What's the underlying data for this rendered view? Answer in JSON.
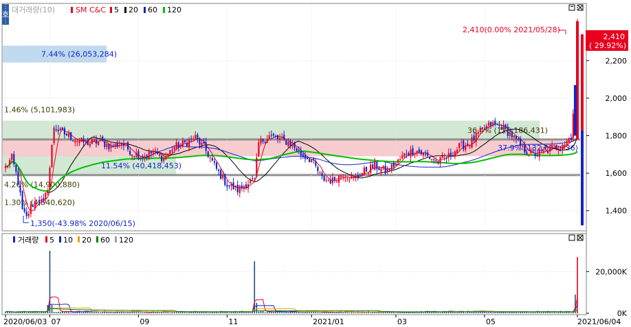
{
  "side_tab": "호",
  "price_pane": {
    "legend": {
      "title": "대거래량(10)",
      "stock": "SM C&C",
      "ma_items": [
        {
          "label": "5",
          "color": "#e8001e"
        },
        {
          "label": "20",
          "color": "#000000"
        },
        {
          "label": "60",
          "color": "#1024c8"
        },
        {
          "label": "120",
          "color": "#00c000"
        }
      ]
    },
    "y_ticks": [
      "2,200",
      "2,000",
      "1,800",
      "1,600",
      "1,400"
    ],
    "high_annotation": "2,410(0.00% 2021/05/28)",
    "low_annotation": "1,350(-43.98% 2020/06/15)",
    "current_price": "2,410",
    "current_change": "( 29.92%)",
    "volume_profile": [
      {
        "label": "7.44% (26,053,284)",
        "low": 2190,
        "high": 2280,
        "color": "#b8d6ec",
        "width": 0.18
      },
      {
        "label": "1.46% (5,101,983)",
        "low": 1880,
        "high": 2000,
        "color": "#ffffff",
        "width": 0.13
      },
      {
        "label": "36.4% (128,186,431)",
        "low": 1780,
        "high": 1880,
        "color": "#cde6cf",
        "width": 0.93
      },
      {
        "label": "37.9% (132,604,736)",
        "low": 1690,
        "high": 1780,
        "color": "#f5c6c9",
        "width": 0.97
      },
      {
        "label": "11.54% (40,418,453)",
        "low": 1590,
        "high": 1690,
        "color": "#cde6cf",
        "width": 0.3
      },
      {
        "label": "4.26% (14,900,880)",
        "low": 1490,
        "high": 1590,
        "color": "#ffffff",
        "width": 0.11
      },
      {
        "label": "1.30% (4,540,620)",
        "low": 1400,
        "high": 1490,
        "color": "#ffffff",
        "width": 0.1
      }
    ],
    "support_lines": [
      1780,
      1590
    ]
  },
  "volume_pane": {
    "legend": {
      "title": "거래량",
      "ma_items": [
        {
          "label": "5",
          "color": "#e8001e"
        },
        {
          "label": "10",
          "color": "#1024c8"
        },
        {
          "label": "20",
          "color": "#e8a000"
        },
        {
          "label": "60",
          "color": "#008000"
        },
        {
          "label": "120",
          "color": "#a0a0a0"
        }
      ]
    },
    "y_ticks": [
      "20,000K",
      "0K"
    ]
  },
  "x_labels": [
    "2020/06/03",
    "07",
    "09",
    "11",
    "2021/01",
    "03",
    "05",
    "2021/06/04"
  ],
  "chart_data": {
    "type": "candlestick",
    "ylim": [
      1300,
      2450
    ],
    "volume_ylim": [
      0,
      33000
    ],
    "price_points": [
      [
        0,
        1630
      ],
      [
        3,
        1680
      ],
      [
        6,
        1560
      ],
      [
        8,
        1400
      ],
      [
        10,
        1360
      ],
      [
        12,
        1420
      ],
      [
        15,
        1460
      ],
      [
        18,
        1440
      ],
      [
        20,
        1520
      ],
      [
        23,
        1850
      ],
      [
        26,
        1820
      ],
      [
        30,
        1800
      ],
      [
        35,
        1770
      ],
      [
        40,
        1760
      ],
      [
        45,
        1770
      ],
      [
        50,
        1740
      ],
      [
        55,
        1760
      ],
      [
        60,
        1710
      ],
      [
        65,
        1690
      ],
      [
        70,
        1710
      ],
      [
        75,
        1680
      ],
      [
        80,
        1740
      ],
      [
        85,
        1760
      ],
      [
        90,
        1790
      ],
      [
        95,
        1720
      ],
      [
        100,
        1620
      ],
      [
        105,
        1540
      ],
      [
        110,
        1510
      ],
      [
        115,
        1550
      ],
      [
        118,
        1560
      ],
      [
        120,
        1760
      ],
      [
        125,
        1800
      ],
      [
        130,
        1780
      ],
      [
        135,
        1760
      ],
      [
        140,
        1700
      ],
      [
        145,
        1670
      ],
      [
        150,
        1570
      ],
      [
        155,
        1560
      ],
      [
        160,
        1600
      ],
      [
        165,
        1570
      ],
      [
        170,
        1610
      ],
      [
        175,
        1640
      ],
      [
        180,
        1610
      ],
      [
        185,
        1650
      ],
      [
        190,
        1710
      ],
      [
        195,
        1720
      ],
      [
        200,
        1690
      ],
      [
        205,
        1660
      ],
      [
        210,
        1690
      ],
      [
        215,
        1740
      ],
      [
        220,
        1760
      ],
      [
        225,
        1820
      ],
      [
        230,
        1860
      ],
      [
        235,
        1850
      ],
      [
        240,
        1800
      ],
      [
        245,
        1730
      ],
      [
        250,
        1700
      ],
      [
        255,
        1710
      ],
      [
        260,
        1740
      ],
      [
        265,
        1760
      ],
      [
        268,
        1800
      ],
      [
        270,
        2050
      ],
      [
        271,
        2410
      ]
    ],
    "x_ticks": [
      {
        "index": 0,
        "label": "2020/06/03"
      },
      {
        "index": 21,
        "label": "07"
      },
      {
        "index": 63,
        "label": "09"
      },
      {
        "index": 105,
        "label": "11"
      },
      {
        "index": 145,
        "label": "2021/01"
      },
      {
        "index": 185,
        "label": "03"
      },
      {
        "index": 227,
        "label": "05"
      },
      {
        "index": 271,
        "label": "2021/06/04"
      }
    ]
  }
}
